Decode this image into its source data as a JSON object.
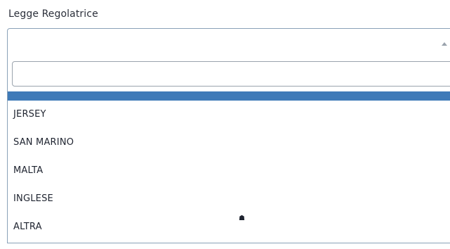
{
  "field": {
    "label": "Legge Regolatrice",
    "selected_value": ""
  },
  "dropdown": {
    "search": {
      "value": "",
      "placeholder": ""
    },
    "options": [
      {
        "label": "JERSEY"
      },
      {
        "label": "SAN MARINO"
      },
      {
        "label": "MALTA"
      },
      {
        "label": "INGLESE"
      },
      {
        "label": "ALTRA"
      }
    ]
  },
  "colors": {
    "highlight": "#3f7ab8",
    "border": "#8aa1b8",
    "text": "#1f2430"
  },
  "icons": {
    "caret": "caret-up-icon",
    "cursor": "mouse-cursor-icon"
  }
}
